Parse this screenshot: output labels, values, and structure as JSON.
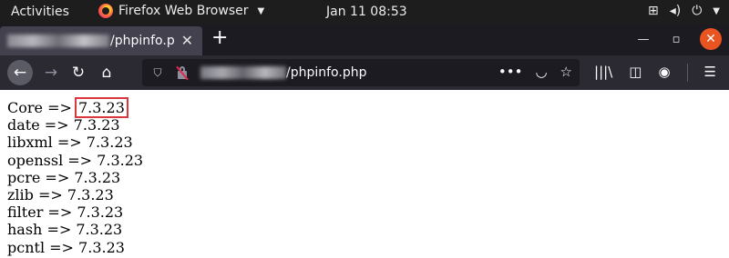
{
  "topbar": {
    "activities": "Activities",
    "app_name": "Firefox Web Browser",
    "clock": "Jan 11  08:53"
  },
  "tab": {
    "title": "/phpinfo.p"
  },
  "urlbar": {
    "url_visible": "/phpinfo.php"
  },
  "content": {
    "lines": [
      {
        "name": "Core",
        "arrow": " => ",
        "version": "7.3.23"
      },
      {
        "name": "date",
        "arrow": " => ",
        "version": "7.3.23"
      },
      {
        "name": "libxml",
        "arrow": " => ",
        "version": "7.3.23"
      },
      {
        "name": "openssl",
        "arrow": " => ",
        "version": "7.3.23"
      },
      {
        "name": "pcre",
        "arrow": " => ",
        "version": "7.3.23"
      },
      {
        "name": "zlib",
        "arrow": " => ",
        "version": "7.3.23"
      },
      {
        "name": "filter",
        "arrow": " => ",
        "version": "7.3.23"
      },
      {
        "name": "hash",
        "arrow": " => ",
        "version": "7.3.23"
      },
      {
        "name": "pcntl",
        "arrow": " => ",
        "version": "7.3.23"
      }
    ]
  },
  "highlight_color": "#d9363e"
}
